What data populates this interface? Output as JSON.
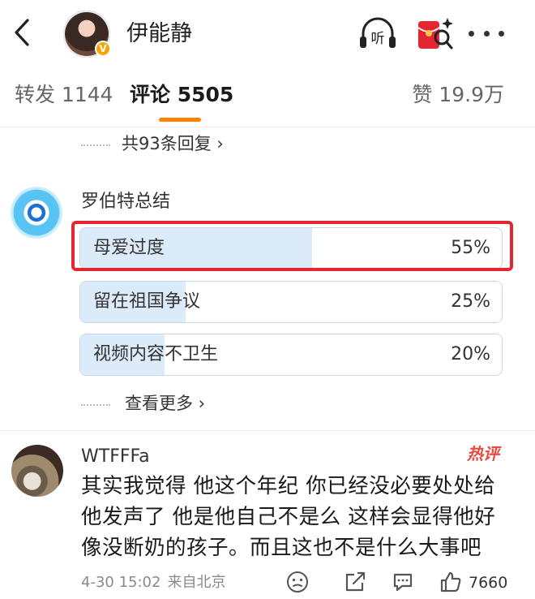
{
  "header": {
    "author_name": "伊能静",
    "listen_label": "听"
  },
  "tabs": {
    "repost": "转发 1144",
    "comment": "评论 5505",
    "like": "赞 19.9万"
  },
  "replies_link": "共93条回复 ›",
  "bot_comment": {
    "name": "罗伯特总结",
    "poll": [
      {
        "label": "母爱过度",
        "percent_text": "55%",
        "fraction": 0.55,
        "highlighted": true
      },
      {
        "label": "留在祖国争议",
        "percent_text": "25%",
        "fraction": 0.25,
        "highlighted": false
      },
      {
        "label": "视频内容不卫生",
        "percent_text": "20%",
        "fraction": 0.2,
        "highlighted": false
      }
    ],
    "see_more": "查看更多 ›"
  },
  "user_comment": {
    "name": "WTFFFa",
    "badge": "热评",
    "text": "其实我觉得 他这个年纪 你已经没必要处处给他发声了 他是他自己不是么 这样会显得他好像没断奶的孩子。而且这也不是什么大事吧",
    "date": "4-30 15:02",
    "location": "来自北京",
    "like_count": "7660"
  },
  "colors": {
    "accent": "#ff8200",
    "highlight": "#e3262f",
    "poll_fill": "#dcebf9",
    "hot_badge": "#e94a3c"
  },
  "icons": [
    "back-arrow-icon",
    "verified-icon",
    "headphones-icon",
    "red-packet-icon",
    "more-icon",
    "emoji-icon",
    "share-icon",
    "comment-icon",
    "thumbs-up-icon"
  ]
}
